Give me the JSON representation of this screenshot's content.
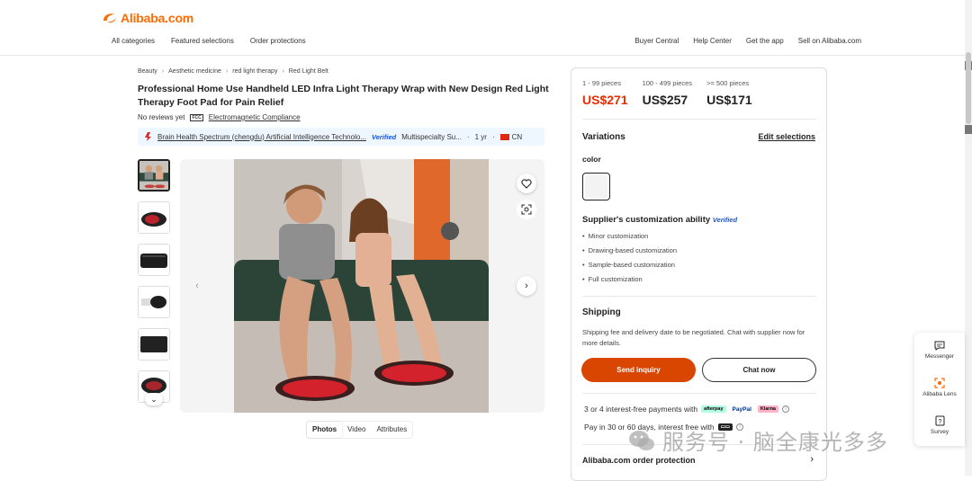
{
  "header": {
    "logo_text": "Alibaba.com",
    "nav_left": [
      "All categories",
      "Featured selections",
      "Order protections"
    ],
    "nav_right": [
      "Buyer Central",
      "Help Center",
      "Get the app",
      "Sell on Alibaba.com"
    ]
  },
  "breadcrumb": [
    "Beauty",
    "Aesthetic medicine",
    "red light therapy",
    "Red Light Belt"
  ],
  "product": {
    "title": "Professional Home Use Handheld LED Infra Light Therapy Wrap with New Design Red Light Therapy Foot Pad for Pain Relief",
    "reviews": "No reviews yet",
    "cert_badge": "FCC",
    "compliance": "Electromagnetic Compliance"
  },
  "supplier": {
    "name": "Brain Health Spectrum (chengdu) Artificial Intelligence Technolo...",
    "verified": "Verified",
    "type": "Multispecialty Su...",
    "years": "1 yr",
    "country": "CN"
  },
  "media_tabs": [
    "Photos",
    "Video",
    "Attributes"
  ],
  "pricing": {
    "tiers": [
      {
        "qty": "1 - 99 pieces",
        "price": "US$271"
      },
      {
        "qty": "100 - 499 pieces",
        "price": "US$257"
      },
      {
        "qty": ">= 500 pieces",
        "price": "US$171"
      }
    ]
  },
  "variations": {
    "title": "Variations",
    "edit_label": "Edit selections",
    "color_label": "color"
  },
  "customization": {
    "title": "Supplier's customization ability",
    "verified": "Verified",
    "items": [
      "Minor customization",
      "Drawing-based customization",
      "Sample-based customization",
      "Full customization"
    ]
  },
  "shipping": {
    "title": "Shipping",
    "text": "Shipping fee and delivery date to be negotiated. Chat with supplier now for more details."
  },
  "actions": {
    "inquiry": "Send inquiry",
    "chat": "Chat now"
  },
  "payments": {
    "interest_free": "3 or 4 interest-free payments with",
    "pay_later": "Pay in 30 or 60 days, interest free with",
    "logos": [
      "afterpay",
      "PayPal",
      "Klarna"
    ]
  },
  "protection": "Alibaba.com order protection",
  "float_bar": {
    "messenger": "Messenger",
    "lens": "Alibaba Lens",
    "survey": "Survey"
  },
  "watermark": "服务号 · 脑全康光多多",
  "colors": {
    "brand": "#ff6a00",
    "price_red": "#e62e04",
    "inquiry_bg": "#d94602",
    "verified_blue": "#1a57d6"
  }
}
